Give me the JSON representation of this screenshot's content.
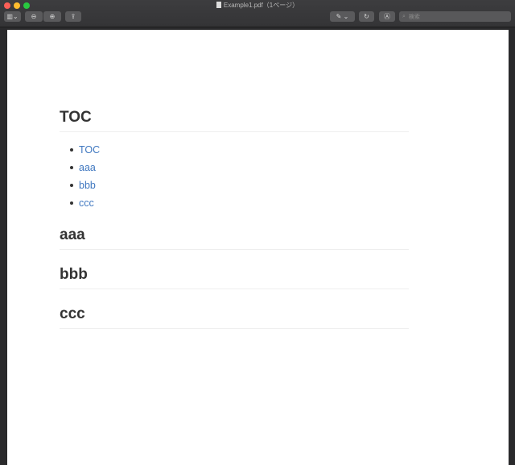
{
  "window": {
    "title": "Example1.pdf（1ページ）"
  },
  "toolbar": {
    "search_placeholder": "検索",
    "icons": [
      "sidebar-icon",
      "zoom-out-icon",
      "zoom-in-icon",
      "share-icon",
      "markup-pen-icon",
      "rotate-icon",
      "annotate-icon",
      "search-icon"
    ]
  },
  "document": {
    "toc_heading": "TOC",
    "toc_items": [
      {
        "label": "TOC"
      },
      {
        "label": "aaa"
      },
      {
        "label": "bbb"
      },
      {
        "label": "ccc"
      }
    ],
    "sections": [
      {
        "heading": "aaa"
      },
      {
        "heading": "bbb"
      },
      {
        "heading": "ccc"
      }
    ],
    "link_color": "#4078c0"
  }
}
